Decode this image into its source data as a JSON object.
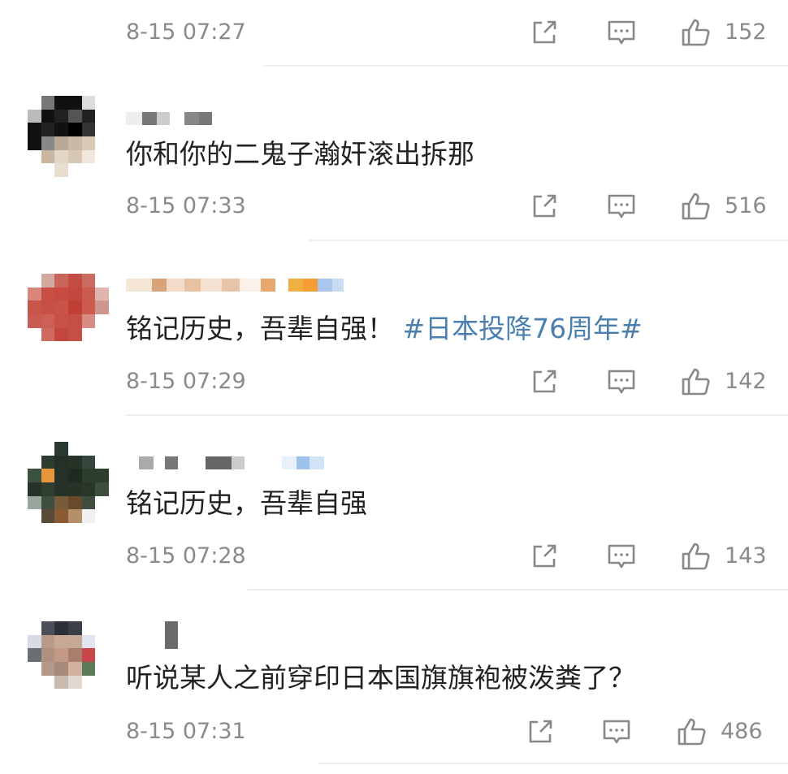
{
  "colors": {
    "hashtag": "#4a7fb0",
    "meta": "#8a8a8a",
    "text": "#222222",
    "divider": "#ededed"
  },
  "comments": [
    {
      "text": "",
      "time": "8-15 07:27",
      "likes": "152"
    },
    {
      "text": "你和你的二鬼子瀚奸滚出拆那",
      "time": "8-15 07:33",
      "likes": "516"
    },
    {
      "text": "铭记历史，吾辈自强！",
      "hashtag": "#日本投降76周年#",
      "time": "8-15 07:29",
      "likes": "142"
    },
    {
      "text": "铭记历史，吾辈自强",
      "time": "8-15 07:28",
      "likes": "143"
    },
    {
      "text": "听说某人之前穿印日本国旗旗袍被泼粪了？",
      "time": "8-15 07:31",
      "likes": "486"
    }
  ],
  "icons": {
    "share": "share-icon",
    "comment": "comment-icon",
    "like": "thumbs-up-icon"
  }
}
